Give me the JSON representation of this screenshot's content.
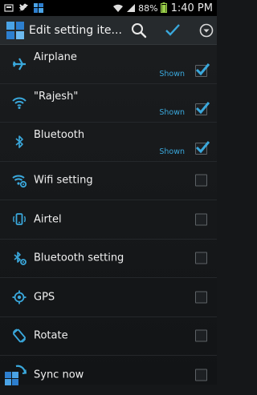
{
  "status_bar": {
    "notification_icons": [
      "usb-icon",
      "twitter-icon",
      "app-icon"
    ],
    "wifi_icon": "wifi-icon",
    "signal_icon": "signal-icon",
    "battery_percent": "88%",
    "battery_icon": "battery-icon",
    "time": "1:40 PM"
  },
  "action_bar": {
    "app_icon": "app-icon",
    "title": "Edit setting ite...",
    "search_icon": "search-icon",
    "check_icon": "check-icon",
    "overflow_icon": "dropdown-icon"
  },
  "accent_color": "#3aa8dc",
  "items": [
    {
      "label": "Airplane",
      "status": "Shown",
      "checked": true,
      "icon": "airplane-icon"
    },
    {
      "label": "\"Rajesh\"",
      "status": "Shown",
      "checked": true,
      "icon": "wifi-icon"
    },
    {
      "label": "Bluetooth",
      "status": "Shown",
      "checked": true,
      "icon": "bluetooth-icon"
    },
    {
      "label": "Wifi setting",
      "status": "",
      "checked": false,
      "icon": "wifi-settings-icon"
    },
    {
      "label": "Airtel",
      "status": "",
      "checked": false,
      "icon": "phone-signal-icon"
    },
    {
      "label": "Bluetooth setting",
      "status": "",
      "checked": false,
      "icon": "bluetooth-settings-icon"
    },
    {
      "label": "GPS",
      "status": "",
      "checked": false,
      "icon": "gps-icon"
    },
    {
      "label": "Rotate",
      "status": "",
      "checked": false,
      "icon": "rotate-icon"
    },
    {
      "label": "Sync now",
      "status": "",
      "checked": false,
      "icon": "sync-icon"
    }
  ]
}
